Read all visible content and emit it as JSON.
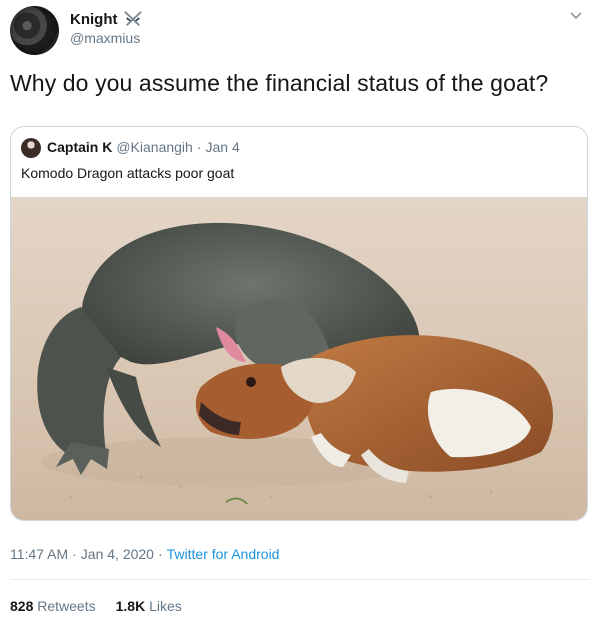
{
  "author": {
    "name": "Knight",
    "handle": "@maxmius",
    "badge_icon": "crossed-swords-icon"
  },
  "tweet": {
    "text": "Why do you assume the financial status of the goat?"
  },
  "quoted_tweet": {
    "name": "Captain K",
    "handle": "@Kianangih",
    "separator": "·",
    "date": "Jan 4",
    "text": "Komodo Dragon attacks poor goat",
    "image_icon": "komodo-dragon-goat-photo"
  },
  "meta": {
    "time": "11:47 AM",
    "separator1": "·",
    "date": "Jan 4, 2020",
    "separator2": "·",
    "source": "Twitter for Android"
  },
  "stats": {
    "retweets_count": "828",
    "retweets_label": "Retweets",
    "likes_count": "1.8K",
    "likes_label": "Likes"
  },
  "colors": {
    "link": "#1b95e0",
    "secondary_text": "#657786",
    "border": "#ccd6dd"
  }
}
